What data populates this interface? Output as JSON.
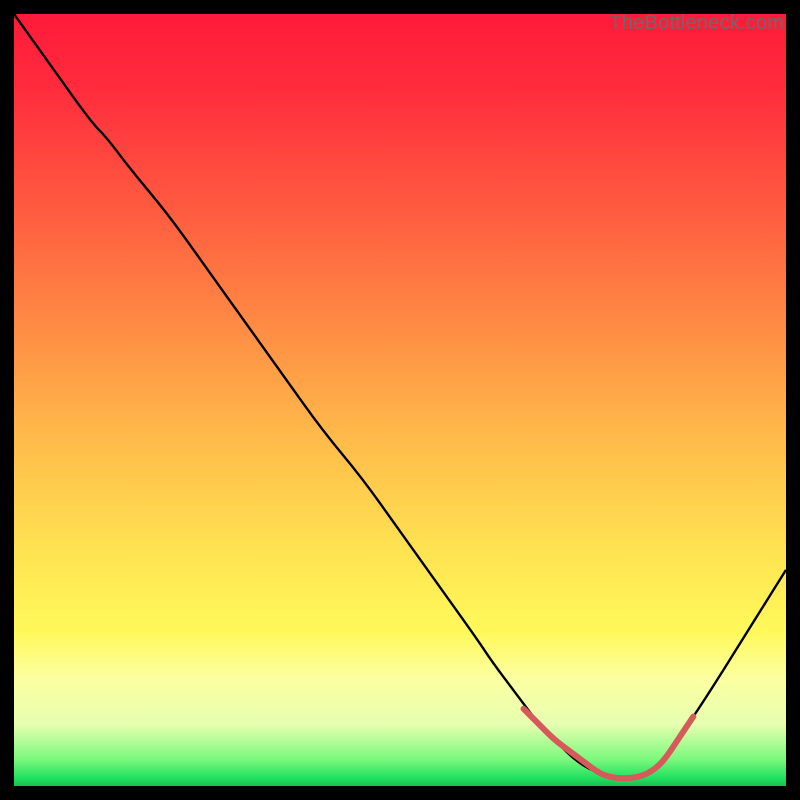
{
  "watermark": "TheBottleneck.com",
  "gradient_stops": [
    {
      "offset": "0%",
      "color": "#ff1a3a"
    },
    {
      "offset": "10%",
      "color": "#ff2d3d"
    },
    {
      "offset": "25%",
      "color": "#ff5a40"
    },
    {
      "offset": "40%",
      "color": "#ff8a44"
    },
    {
      "offset": "55%",
      "color": "#ffbb4a"
    },
    {
      "offset": "70%",
      "color": "#ffe452"
    },
    {
      "offset": "80%",
      "color": "#fff95a"
    },
    {
      "offset": "86%",
      "color": "#fcffa0"
    },
    {
      "offset": "92%",
      "color": "#e6ffb0"
    },
    {
      "offset": "96.5%",
      "color": "#7cf97e"
    },
    {
      "offset": "99%",
      "color": "#20e060"
    },
    {
      "offset": "100%",
      "color": "#18c050"
    }
  ],
  "chart_data": {
    "type": "line",
    "title": "",
    "xlabel": "",
    "ylabel": "",
    "xlim": [
      0,
      100
    ],
    "ylim": [
      0,
      100
    ],
    "series": [
      {
        "name": "bottleneck-curve",
        "stroke": "#000000",
        "stroke_width": 2.4,
        "x": [
          0,
          5,
          10,
          12,
          15,
          20,
          25,
          30,
          35,
          40,
          45,
          50,
          55,
          60,
          62,
          65,
          68,
          70,
          73,
          76,
          79,
          82,
          84,
          86,
          90,
          95,
          100
        ],
        "values": [
          100,
          93,
          86,
          84,
          80,
          74,
          67,
          60,
          53,
          46,
          40,
          33,
          26,
          19,
          16,
          12,
          8,
          6,
          3,
          1.5,
          1,
          1.5,
          3,
          6,
          12,
          20,
          28
        ]
      },
      {
        "name": "optimal-range-highlight",
        "stroke": "#d65a5a",
        "stroke_width": 6.0,
        "linecap": "round",
        "x": [
          66,
          68,
          70,
          72,
          74,
          76,
          78,
          80,
          82,
          84,
          86,
          88
        ],
        "values": [
          10,
          8,
          6,
          4.5,
          3,
          1.5,
          1,
          1,
          1.5,
          3,
          6,
          9
        ]
      }
    ]
  }
}
